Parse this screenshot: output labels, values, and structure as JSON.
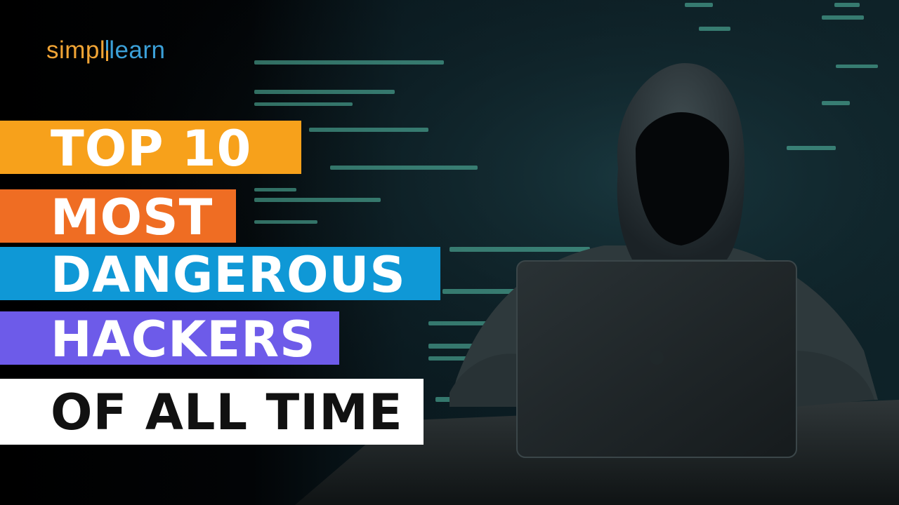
{
  "logo": {
    "part1": "simpl",
    "part2": "learn"
  },
  "title": {
    "line1": "TOP 10",
    "line2": "MOST",
    "line3": "DANGEROUS",
    "line4": "HACKERS",
    "line5": "OF ALL TIME"
  },
  "colors": {
    "band1": "#f7a11b",
    "band2": "#ef6d23",
    "band3": "#0f98d6",
    "band4": "#6d5be9",
    "band5": "#ffffff",
    "code_text": "#5fd3b8"
  }
}
